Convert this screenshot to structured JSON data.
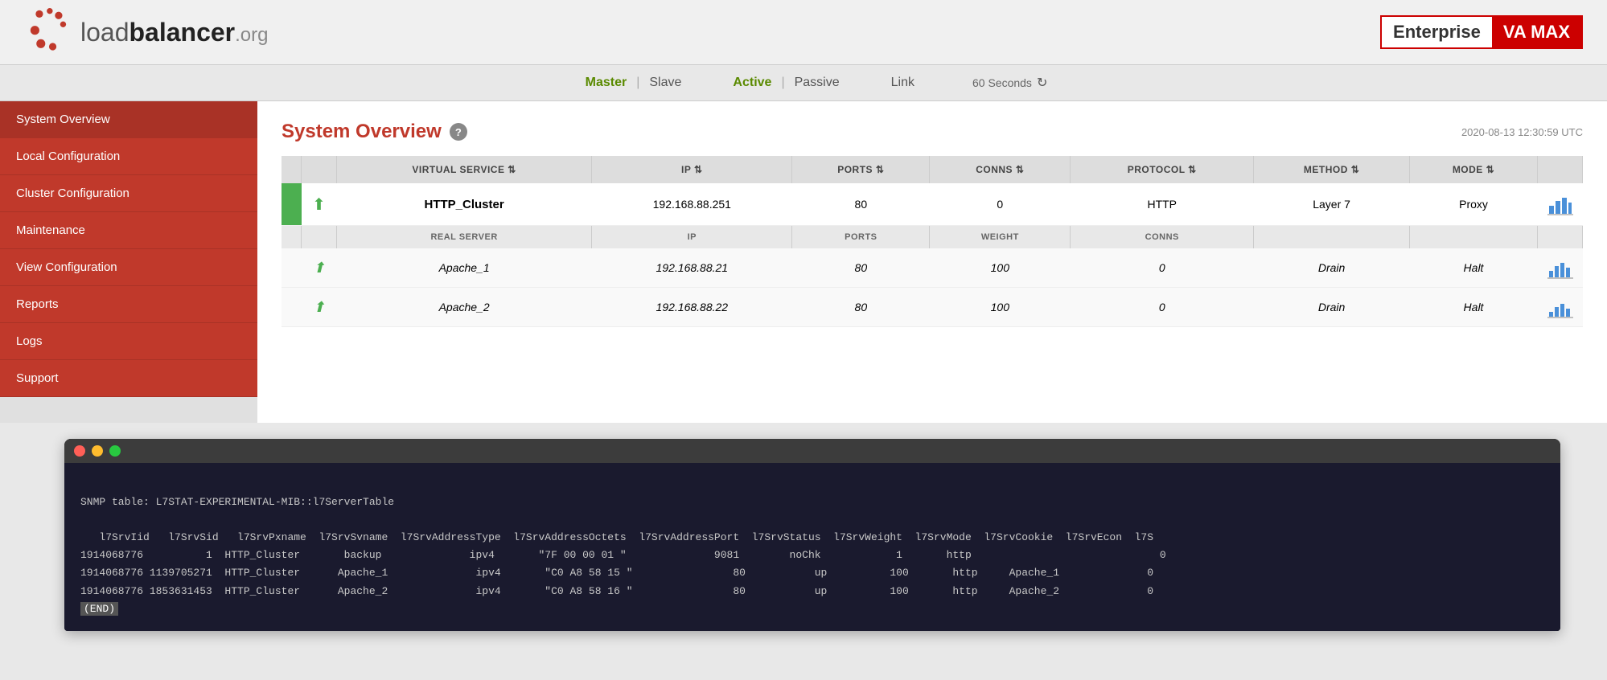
{
  "header": {
    "logo_text_load": "load",
    "logo_text_balancer": "balancer",
    "logo_text_org": ".org",
    "enterprise_label": "Enterprise",
    "va_max_label": "VA MAX"
  },
  "nav": {
    "master_label": "Master",
    "slave_label": "Slave",
    "active_label": "Active",
    "passive_label": "Passive",
    "link_label": "Link",
    "refresh_label": "60 Seconds"
  },
  "sidebar": {
    "items": [
      {
        "id": "system-overview",
        "label": "System Overview",
        "active": true
      },
      {
        "id": "local-configuration",
        "label": "Local Configuration",
        "active": false
      },
      {
        "id": "cluster-configuration",
        "label": "Cluster Configuration",
        "active": false
      },
      {
        "id": "maintenance",
        "label": "Maintenance",
        "active": false
      },
      {
        "id": "view-configuration",
        "label": "View Configuration",
        "active": false
      },
      {
        "id": "reports",
        "label": "Reports",
        "active": false
      },
      {
        "id": "logs",
        "label": "Logs",
        "active": false
      },
      {
        "id": "support",
        "label": "Support",
        "active": false
      }
    ]
  },
  "content": {
    "page_title": "System Overview",
    "timestamp": "2020-08-13 12:30:59 UTC",
    "table_headers": [
      "VIRTUAL SERVICE ⇕",
      "IP ⇕",
      "PORTS ⇕",
      "CONNS ⇕",
      "PROTOCOL ⇕",
      "METHOD ⇕",
      "MODE ⇕"
    ],
    "rs_headers": [
      "REAL SERVER",
      "IP",
      "PORTS",
      "WEIGHT",
      "CONNS"
    ],
    "virtual_services": [
      {
        "name": "HTTP_Cluster",
        "ip": "192.168.88.251",
        "ports": "80",
        "conns": "0",
        "protocol": "HTTP",
        "method": "Layer 7",
        "mode": "Proxy",
        "real_servers": [
          {
            "name": "Apache_1",
            "ip": "192.168.88.21",
            "ports": "80",
            "weight": "100",
            "conns": "0",
            "action1": "Drain",
            "action2": "Halt"
          },
          {
            "name": "Apache_2",
            "ip": "192.168.88.22",
            "ports": "80",
            "weight": "100",
            "conns": "0",
            "action1": "Drain",
            "action2": "Halt"
          }
        ]
      }
    ]
  },
  "terminal": {
    "title": "",
    "content_line1": "SNMP table: L7STAT-EXPERIMENTAL-MIB::l7ServerTable",
    "content_line2": "",
    "header_row": "   l7SrvIid   l7SrvSid   l7SrvPxname  l7SrvSvname  l7SrvAddressType  l7SrvAddressOctets  l7SrvAddressPort  l7SrvStatus  l7SrvWeight  l7SrvMode  l7SrvCookie  l7SrvEcon  l7S",
    "data_row1": "1914068776          1  HTTP_Cluster       backup              ipv4       \"7F 00 00 01 \"              9081        noChk            1       http                              0",
    "data_row2": "1914068776 1139705271  HTTP_Cluster      Apache_1              ipv4       \"C0 A8 58 15 \"                80           up          100       http     Apache_1              0",
    "data_row3": "1914068776 1853631453  HTTP_Cluster      Apache_2              ipv4       \"C0 A8 58 16 \"                80           up          100       http     Apache_2              0",
    "end_label": "(END)"
  }
}
